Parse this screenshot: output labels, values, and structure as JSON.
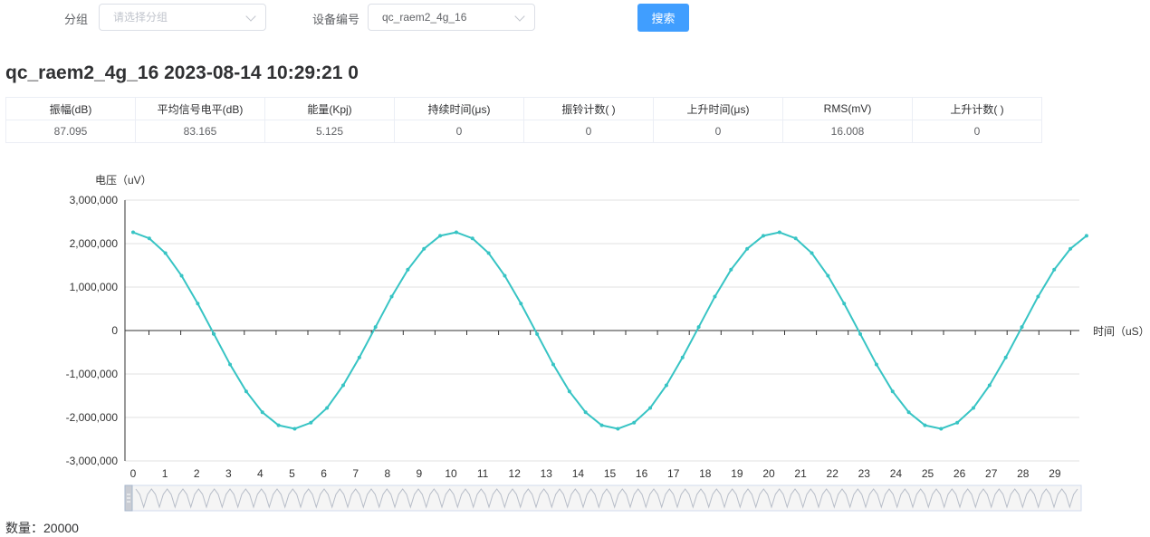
{
  "filters": {
    "group_label": "分组",
    "group_placeholder": "请选择分组",
    "device_label": "设备编号",
    "device_value": "qc_raem2_4g_16",
    "search_button": "搜索"
  },
  "header": {
    "title": "qc_raem2_4g_16 2023-08-14 10:29:21 0"
  },
  "stats_table": {
    "headers": [
      "振幅(dB)",
      "平均信号电平(dB)",
      "能量(Kpj)",
      "持续时间(μs)",
      "振铃计数( )",
      "上升时间(μs)",
      "RMS(mV)",
      "上升计数( )"
    ],
    "values": [
      "87.095",
      "83.165",
      "5.125",
      "0",
      "0",
      "0",
      "16.008",
      "0"
    ]
  },
  "footer": {
    "count_text": "数量：20000"
  },
  "colors": {
    "series": "#37c4c4",
    "primary": "#409eff",
    "grid": "#e0e0e0"
  },
  "chart_data": {
    "type": "line",
    "ylabel": "电压（uV）",
    "xlabel": "时间（uS）",
    "ylim": [
      -3000000,
      3000000
    ],
    "yticks": [
      3000000,
      2000000,
      1000000,
      0,
      -1000000,
      -2000000,
      -3000000
    ],
    "ytick_labels": [
      "3,000,000",
      "2,000,000",
      "1,000,000",
      "0",
      "-1,000,000",
      "-2,000,000",
      "-3,000,000"
    ],
    "categories": [
      "0",
      "1",
      "2",
      "3",
      "4",
      "5",
      "6",
      "7",
      "8",
      "9",
      "10",
      "11",
      "12",
      "13",
      "14",
      "15",
      "16",
      "17",
      "18",
      "19",
      "20",
      "21",
      "22",
      "23",
      "24",
      "25",
      "26",
      "27",
      "28",
      "29"
    ],
    "series": [
      {
        "values": [
          2260000,
          2120000,
          1780000,
          1260000,
          620000,
          -80000,
          -780000,
          -1400000,
          -1880000,
          -2180000,
          -2260000,
          -2120000,
          -1780000,
          -1260000,
          -620000,
          80000,
          780000,
          1400000,
          1880000,
          2180000,
          2260000,
          2120000,
          1780000,
          1260000,
          620000,
          -80000,
          -780000,
          -1400000,
          -1880000,
          -2180000,
          -2260000,
          -2120000,
          -1780000,
          -1260000,
          -620000,
          80000,
          780000,
          1400000,
          1880000,
          2180000,
          2260000,
          2120000,
          1780000,
          1260000,
          620000,
          -80000,
          -780000,
          -1400000,
          -1880000,
          -2180000,
          -2260000,
          -2120000,
          -1780000,
          -1260000,
          -620000,
          80000,
          780000,
          1400000,
          1880000,
          2180000
        ]
      }
    ],
    "grid": true,
    "data_zoom": true
  }
}
